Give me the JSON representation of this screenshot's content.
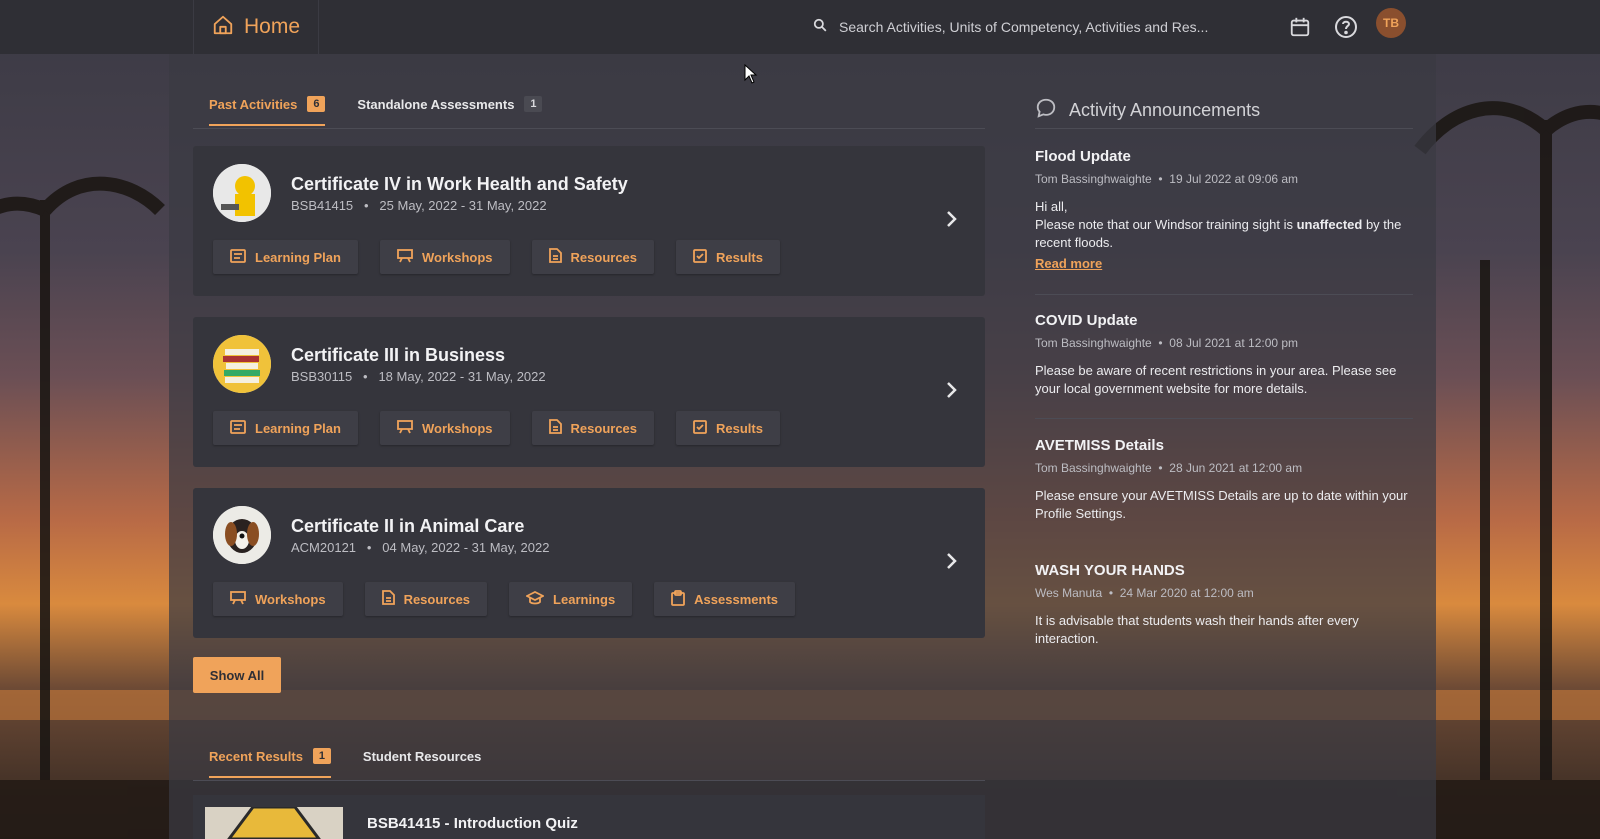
{
  "header": {
    "title": "Home",
    "search_placeholder": "Search Activities, Units of Competency, Activities and Res...",
    "avatar_initials": "TB",
    "accent_color": "#f0a35a"
  },
  "activity_tabs": [
    {
      "label": "Past Activities",
      "count": "6",
      "active": true
    },
    {
      "label": "Standalone Assessments",
      "count": "1",
      "active": false
    }
  ],
  "activities": [
    {
      "title": "Certificate IV in Work Health and Safety",
      "code": "BSB41415",
      "dates": "25 May, 2022 - 31 May, 2022",
      "actions": [
        {
          "label": "Learning Plan",
          "icon": "learning-plan-icon"
        },
        {
          "label": "Workshops",
          "icon": "workshop-icon"
        },
        {
          "label": "Resources",
          "icon": "document-icon"
        },
        {
          "label": "Results",
          "icon": "results-icon"
        }
      ]
    },
    {
      "title": "Certificate III in Business",
      "code": "BSB30115",
      "dates": "18 May, 2022 - 31 May, 2022",
      "actions": [
        {
          "label": "Learning Plan",
          "icon": "learning-plan-icon"
        },
        {
          "label": "Workshops",
          "icon": "workshop-icon"
        },
        {
          "label": "Resources",
          "icon": "document-icon"
        },
        {
          "label": "Results",
          "icon": "results-icon"
        }
      ]
    },
    {
      "title": "Certificate II in Animal Care",
      "code": "ACM20121",
      "dates": "04 May, 2022 - 31 May, 2022",
      "actions": [
        {
          "label": "Workshops",
          "icon": "workshop-icon"
        },
        {
          "label": "Resources",
          "icon": "document-icon"
        },
        {
          "label": "Learnings",
          "icon": "graduation-cap-icon"
        },
        {
          "label": "Assessments",
          "icon": "clipboard-icon"
        }
      ]
    }
  ],
  "show_all_label": "Show All",
  "bottom_tabs": [
    {
      "label": "Recent Results",
      "count": "1",
      "active": true
    },
    {
      "label": "Student Resources",
      "count": null,
      "active": false
    }
  ],
  "recent_result": {
    "title": "BSB41415 - Introduction Quiz"
  },
  "announcements": {
    "header": "Activity Announcements",
    "items": [
      {
        "title": "Flood Update",
        "author": "Tom Bassinghwaighte",
        "date": "19 Jul 2022 at 09:06 am",
        "greeting": "Hi all,",
        "body_pre": "Please note that our Windsor training sight is ",
        "body_bold": "unaffected",
        "body_post": " by the recent floods.",
        "link": "Read more"
      },
      {
        "title": "COVID Update",
        "author": "Tom Bassinghwaighte",
        "date": "08 Jul 2021 at 12:00 pm",
        "body": "Please be aware of recent restrictions in your area. Please see your local government website for more details."
      },
      {
        "title": "AVETMISS Details",
        "author": "Tom Bassinghwaighte",
        "date": "28 Jun 2021 at 12:00 am",
        "body": "Please ensure your AVETMISS Details are up to date within your Profile Settings."
      },
      {
        "title": "WASH YOUR HANDS",
        "author": "Wes Manuta",
        "date": "24 Mar 2020 at 12:00 am",
        "body": "It is advisable that students wash their hands after every interaction."
      }
    ]
  }
}
